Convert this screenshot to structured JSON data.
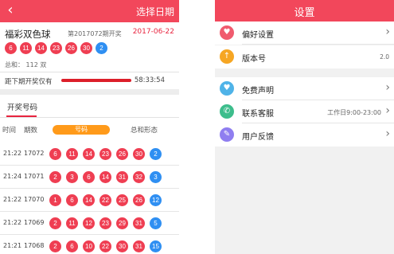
{
  "left": {
    "title_action": "选择日期",
    "back_glyph": "‹",
    "lottery": {
      "name": "福彩双色球",
      "issue": "第2017072期开奖",
      "date": "2017-06-22"
    },
    "balls": [
      {
        "n": "6",
        "c": "red"
      },
      {
        "n": "11",
        "c": "red"
      },
      {
        "n": "14",
        "c": "red"
      },
      {
        "n": "23",
        "c": "red"
      },
      {
        "n": "26",
        "c": "red"
      },
      {
        "n": "30",
        "c": "red"
      },
      {
        "n": "2",
        "c": "blue"
      }
    ],
    "sum_text": "总和： 112 双",
    "countdown": {
      "label": "距下期开奖仅有",
      "time": "58:33:54",
      "progress": 0.9
    },
    "tab": "开奖号码",
    "headers": {
      "time": "时间",
      "issue": "期数",
      "numbers": "号码",
      "form": "总和形态"
    },
    "rows": [
      {
        "time": "21:22",
        "issue": "17072",
        "balls": [
          "6",
          "11",
          "14",
          "23",
          "26",
          "30"
        ],
        "blue": "2"
      },
      {
        "time": "21:24",
        "issue": "17071",
        "balls": [
          "2",
          "3",
          "6",
          "14",
          "31",
          "32"
        ],
        "blue": "3"
      },
      {
        "time": "21:22",
        "issue": "17070",
        "balls": [
          "1",
          "6",
          "14",
          "22",
          "25",
          "26"
        ],
        "blue": "12"
      },
      {
        "time": "21:22",
        "issue": "17069",
        "balls": [
          "2",
          "11",
          "12",
          "23",
          "29",
          "31"
        ],
        "blue": "5"
      },
      {
        "time": "21:21",
        "issue": "17068",
        "balls": [
          "2",
          "6",
          "10",
          "22",
          "30",
          "31"
        ],
        "blue": "15"
      }
    ]
  },
  "right": {
    "title": "设置",
    "items": [
      {
        "label": "偏好设置",
        "icon": "heart-icon",
        "color": "#f05b6e",
        "glyph": "♥",
        "value": "",
        "chevron": true
      },
      {
        "label": "版本号",
        "icon": "upload-arrow-icon",
        "color": "#f6a623",
        "glyph": "↑",
        "value": "2.0",
        "chevron": false
      },
      {
        "label": "免费声明",
        "icon": "heart-badge-icon",
        "color": "#4fb3e8",
        "glyph": "♥",
        "value": "",
        "chevron": true
      },
      {
        "label": "联系客服",
        "icon": "phone-icon",
        "color": "#3dbd8c",
        "glyph": "✆",
        "value": "工作日9:00-23:00",
        "chevron": true
      },
      {
        "label": "用户反馈",
        "icon": "edit-icon",
        "color": "#8f7ef0",
        "glyph": "✎",
        "value": "",
        "chevron": true
      }
    ],
    "chevron_glyph": "›"
  }
}
